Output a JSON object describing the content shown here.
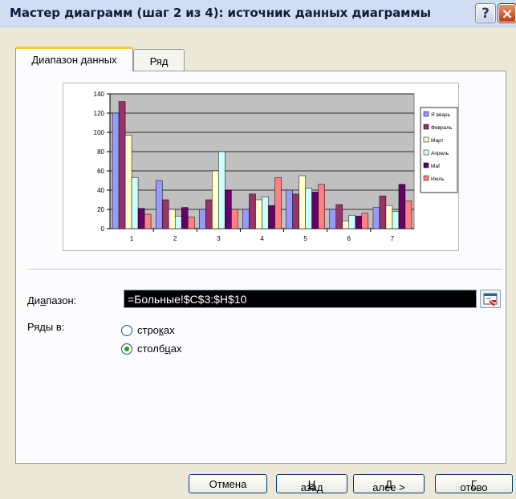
{
  "window": {
    "title": "Мастер диаграмм (шаг 2 из 4): источник данных диаграммы",
    "help_symbol": "?",
    "close_symbol": "×"
  },
  "tabs": [
    {
      "label": "Диапазон данных",
      "active": true
    },
    {
      "label": "Ряд",
      "active": false
    }
  ],
  "form": {
    "range_label_pre": "Ди",
    "range_label_u": "а",
    "range_label_post": "пазон:",
    "range_value": "=Больные!$C$3:$H$10",
    "series_in_label": "Ряды в:",
    "radio_rows_pre": "стро",
    "radio_rows_u": "к",
    "radio_rows_post": "ах",
    "radio_cols_pre": "столб",
    "radio_cols_u": "ц",
    "radio_cols_post": "ах",
    "selected": "columns"
  },
  "buttons": {
    "cancel": "Отмена",
    "back_pre": "< ",
    "back_u": "Н",
    "back_post": "азад",
    "next_u": "Д",
    "next_post": "алее >",
    "finish_u": "Г",
    "finish_post": "отово"
  },
  "chart_data": {
    "type": "bar",
    "categories": [
      "1",
      "2",
      "3",
      "4",
      "5",
      "6",
      "7"
    ],
    "ylim": [
      0,
      140
    ],
    "yticks": [
      "0",
      "20",
      "40",
      "60",
      "80",
      "100",
      "120",
      "140"
    ],
    "grid": true,
    "legend_position": "right",
    "plot_bg": "#c0c0c0",
    "series": [
      {
        "name": "Я ввapь",
        "color": "#9999ff",
        "values": [
          120,
          50,
          20,
          20,
          40,
          20,
          22
        ]
      },
      {
        "name": "Февраль",
        "color": "#993366",
        "values": [
          132,
          30,
          30,
          36,
          36,
          25,
          34
        ]
      },
      {
        "name": "Март",
        "color": "#ffffcc",
        "values": [
          97,
          20,
          60,
          30,
          55,
          8,
          24
        ]
      },
      {
        "name": "Апрель",
        "color": "#ccffff",
        "values": [
          53,
          13,
          80,
          33,
          42,
          14,
          18
        ]
      },
      {
        "name": "Маf",
        "color": "#660066",
        "values": [
          21,
          22,
          40,
          24,
          38,
          13,
          46
        ]
      },
      {
        "name": "Июль",
        "color": "#ff8080",
        "values": [
          15,
          12,
          20,
          53,
          46,
          16,
          29
        ]
      }
    ]
  }
}
